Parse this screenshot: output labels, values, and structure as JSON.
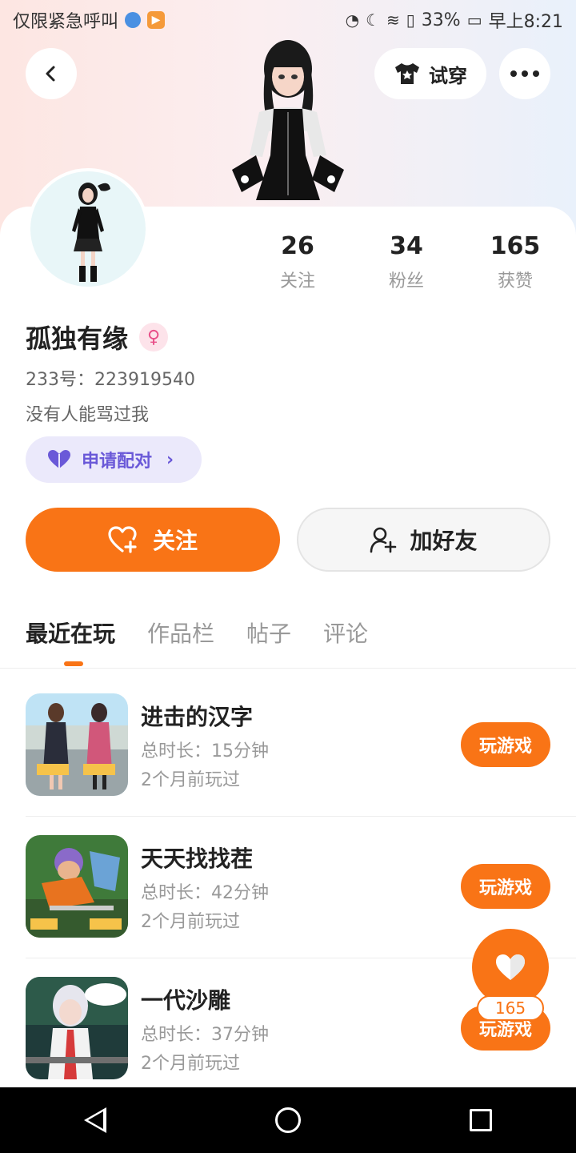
{
  "status_bar": {
    "carrier_text": "仅限紧急呼叫",
    "battery": "33%",
    "time": "早上8:21"
  },
  "header": {
    "tryon_label": "试穿"
  },
  "profile": {
    "stats": [
      {
        "value": "26",
        "label": "关注"
      },
      {
        "value": "34",
        "label": "粉丝"
      },
      {
        "value": "165",
        "label": "获赞"
      }
    ],
    "username": "孤独有缘",
    "gender_icon": "female-symbol",
    "id_text": "233号：223919540",
    "bio": "没有人能骂过我",
    "pair_label": "申请配对"
  },
  "actions": {
    "follow_label": "关注",
    "add_friend_label": "加好友"
  },
  "tabs": [
    {
      "label": "最近在玩",
      "active": true
    },
    {
      "label": "作品栏",
      "active": false
    },
    {
      "label": "帖子",
      "active": false
    },
    {
      "label": "评论",
      "active": false
    }
  ],
  "games": [
    {
      "name": "进击的汉字",
      "duration": "总时长：15分钟",
      "last_played": "2个月前玩过",
      "button": "玩游戏"
    },
    {
      "name": "天天找找茬",
      "duration": "总时长：42分钟",
      "last_played": "2个月前玩过",
      "button": "玩游戏"
    },
    {
      "name": "一代沙雕",
      "duration": "总时长：37分钟",
      "last_played": "2个月前玩过",
      "button": "玩游戏"
    }
  ],
  "like_fab": {
    "count": "165"
  },
  "colors": {
    "accent": "#f97416",
    "pair_purple": "#6a59d8"
  }
}
